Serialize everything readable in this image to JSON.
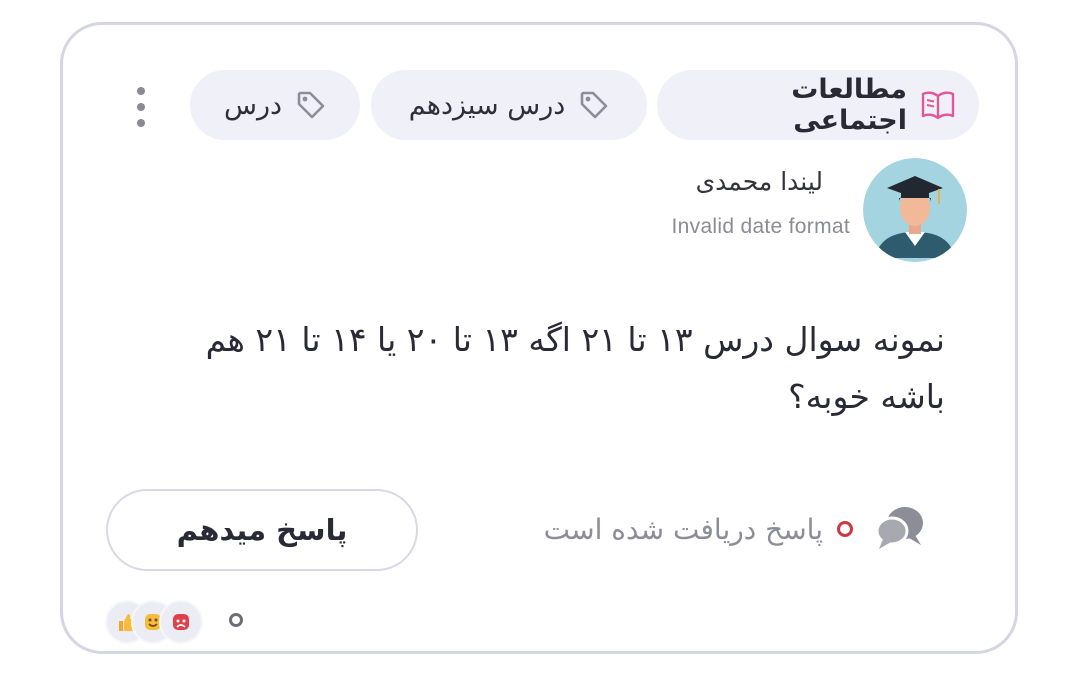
{
  "tags": {
    "primary_label": "مطالعات اجتماعی",
    "secondary_label": "درس سیزدهم",
    "tertiary_label": "درس"
  },
  "author": {
    "name": "لیندا محمدی",
    "date": "Invalid date format"
  },
  "question": {
    "text": "نمونه سوال درس ۱۳ تا ۲۱ اگه ۱۳ تا ۲۰ یا ۱۴ تا ۲۱ هم باشه خوبه؟"
  },
  "status": {
    "text": "پاسخ دریافت شده است"
  },
  "actions": {
    "answer_label": "پاسخ میدهم"
  },
  "reactions": {
    "icons": [
      "angry-face-icon",
      "happy-face-icon",
      "thumbs-up-icon"
    ],
    "count": "0"
  },
  "colors": {
    "accent_pink": "#e0579a",
    "status_red": "#d03642",
    "border": "#d5d6e2",
    "chip_bg": "#f0f0f8"
  }
}
